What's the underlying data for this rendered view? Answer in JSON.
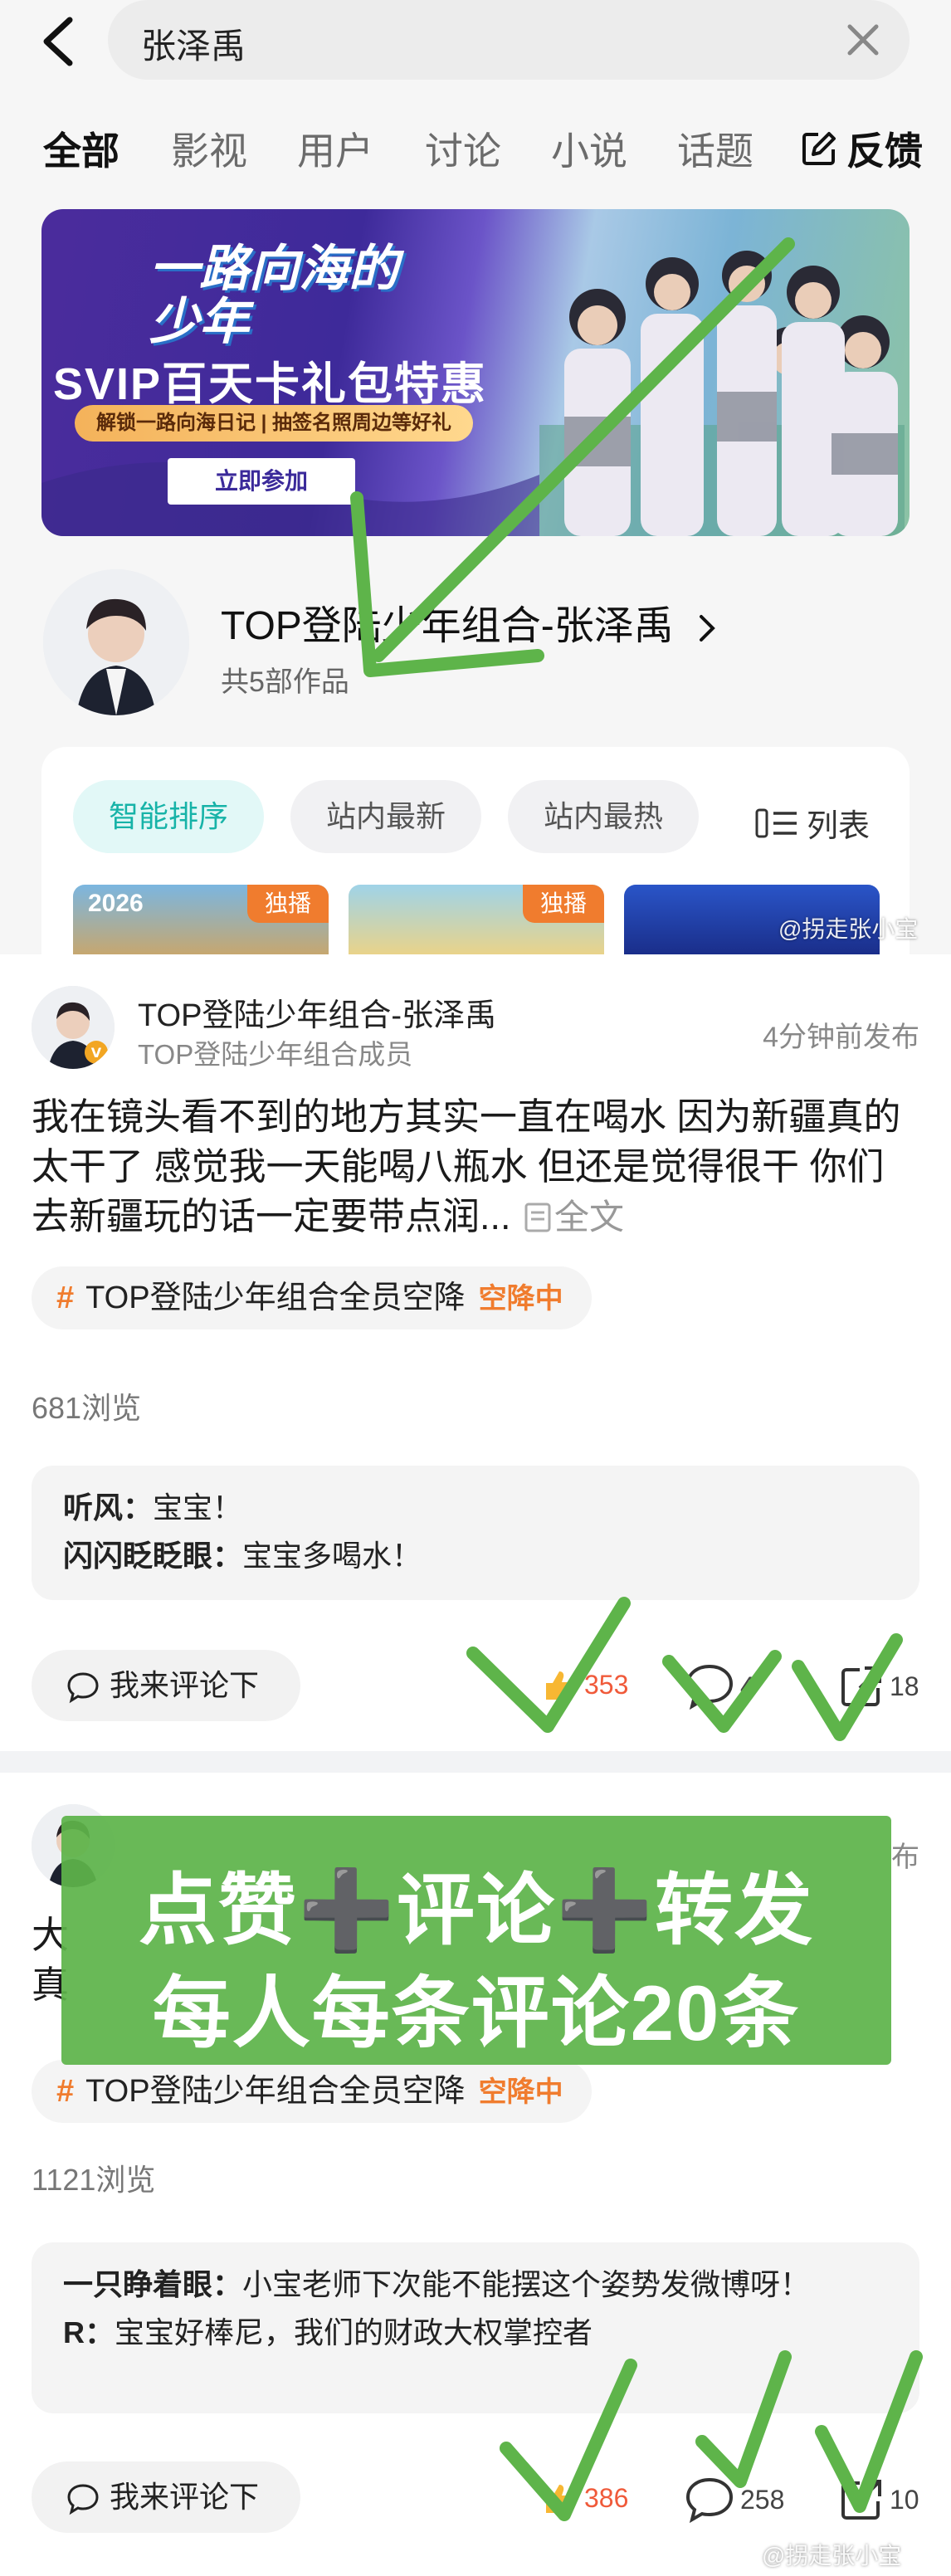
{
  "search": {
    "query": "张泽禹"
  },
  "tabs": [
    {
      "label": "全部"
    },
    {
      "label": "影视"
    },
    {
      "label": "用户"
    },
    {
      "label": "讨论"
    },
    {
      "label": "小说"
    },
    {
      "label": "话题"
    }
  ],
  "feedback_label": "反馈",
  "banner": {
    "logo": "一路向海的少年",
    "title": "SVIP百天卡礼包特惠",
    "subtitle": "解锁一路向海日记 | 抽签名照周边等好礼",
    "button": "立即参加"
  },
  "profile": {
    "name": "TOP登陆少年组合-张泽禹",
    "works": "共5部作品"
  },
  "filters": [
    {
      "label": "智能排序"
    },
    {
      "label": "站内最新"
    },
    {
      "label": "站内最热"
    }
  ],
  "list_view_label": "列表",
  "thumbnails": [
    {
      "year": "2026",
      "badge": "独播"
    },
    {
      "year": "",
      "badge": "独播"
    },
    {
      "year": "",
      "badge": ""
    }
  ],
  "posts": [
    {
      "author": "TOP登陆少年组合-张泽禹",
      "role": "TOP登陆少年组合成员",
      "time": "4分钟前发布",
      "text": "我在镜头看不到的地方其实一直在喝水 因为新疆真的太干了 感觉我一天能喝八瓶水 但还是觉得很干 你们去新疆玩的话一定要带点润...",
      "fulltext_label": "全文",
      "topic": "TOP登陆少年组合全员空降",
      "topic_tag": "空降中",
      "views": "681浏览",
      "comments": [
        {
          "user": "听风：",
          "text": "宝宝！"
        },
        {
          "user": "闪闪眨眨眼：",
          "text": "宝宝多喝水！"
        }
      ],
      "reply_label": "我来评论下",
      "likes": "353",
      "comment_count": "4",
      "shares": "18"
    },
    {
      "author": "",
      "role": "",
      "time": "布",
      "text_line1": "大",
      "text_line2": "真",
      "topic": "TOP登陆少年组合全员空降",
      "topic_tag": "空降中",
      "views": "1121浏览",
      "comments": [
        {
          "user": "一只睁着眼：",
          "text": "小宝老师下次能不能摆这个姿势发微博呀！"
        },
        {
          "user": "R：",
          "text": "宝宝好棒尼，我们的财政大权掌控者"
        }
      ],
      "reply_label": "我来评论下",
      "likes": "386",
      "comment_count": "258",
      "shares": "10"
    }
  ],
  "overlay": {
    "line1": "点赞➕评论➕转发",
    "line2": "每人每条评论20条",
    "color": "#5eb44a"
  },
  "watermark": "@拐走张小宝",
  "accent": "#17b3a8",
  "hot_color": "#f07c2e"
}
